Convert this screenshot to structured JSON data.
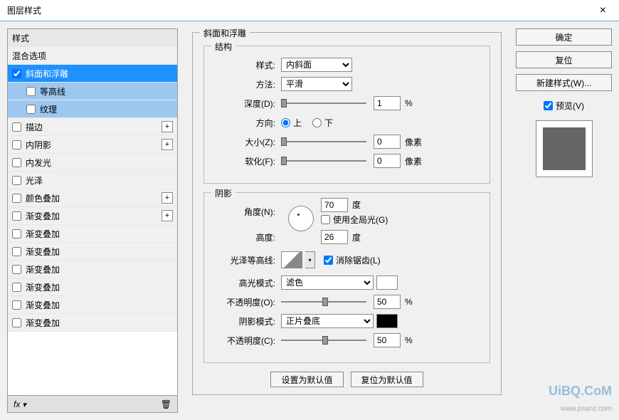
{
  "window": {
    "title": "图层样式",
    "close": "×"
  },
  "sidebar": {
    "header": "样式",
    "blend_options": "混合选项",
    "items": [
      {
        "label": "斜面和浮雕",
        "checked": true,
        "selected": true
      },
      {
        "label": "等高线",
        "sub": true,
        "subselected": true
      },
      {
        "label": "纹理",
        "sub": true,
        "subselected": true
      },
      {
        "label": "描边",
        "add": true
      },
      {
        "label": "内阴影",
        "add": true
      },
      {
        "label": "内发光"
      },
      {
        "label": "光泽"
      },
      {
        "label": "颜色叠加",
        "add": true
      },
      {
        "label": "渐变叠加",
        "add": true
      },
      {
        "label": "渐变叠加"
      },
      {
        "label": "渐变叠加"
      },
      {
        "label": "渐变叠加"
      },
      {
        "label": "渐变叠加"
      },
      {
        "label": "渐变叠加"
      },
      {
        "label": "渐变叠加"
      }
    ],
    "fx": "fx",
    "trash": "🗑"
  },
  "bevel": {
    "section_title": "斜面和浮雕",
    "structure_title": "结构",
    "style_label": "样式:",
    "style_value": "内斜面",
    "technique_label": "方法:",
    "technique_value": "平滑",
    "depth_label": "深度(D):",
    "depth_value": "1",
    "depth_unit": "%",
    "direction_label": "方向:",
    "direction_up": "上",
    "direction_down": "下",
    "size_label": "大小(Z):",
    "size_value": "0",
    "size_unit": "像素",
    "soften_label": "软化(F):",
    "soften_value": "0",
    "soften_unit": "像素"
  },
  "shading": {
    "section_title": "阴影",
    "angle_label": "角度(N):",
    "angle_value": "70",
    "angle_unit": "度",
    "global_light_label": "使用全局光(G)",
    "altitude_label": "高度:",
    "altitude_value": "26",
    "altitude_unit": "度",
    "gloss_contour_label": "光泽等高线:",
    "antialiased_label": "消除锯齿(L)",
    "highlight_mode_label": "高光模式:",
    "highlight_mode_value": "滤色",
    "highlight_opacity_label": "不透明度(O):",
    "highlight_opacity_value": "50",
    "highlight_opacity_unit": "%",
    "shadow_mode_label": "阴影模式:",
    "shadow_mode_value": "正片叠底",
    "shadow_opacity_label": "不透明度(C):",
    "shadow_opacity_value": "50",
    "shadow_opacity_unit": "%"
  },
  "buttons": {
    "make_default": "设置为默认值",
    "reset_default": "复位为默认值",
    "ok": "确定",
    "cancel": "复位",
    "new_style": "新建样式(W)...",
    "preview": "预览(V)"
  },
  "watermark": "UiBQ.CoM",
  "watermark2": "www.psanz.com"
}
